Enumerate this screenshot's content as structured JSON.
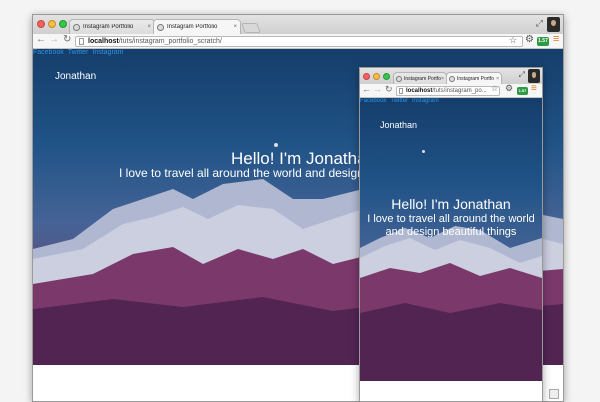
{
  "large_window": {
    "tabs": [
      {
        "title": "Instagram Portfolio",
        "close": "×"
      },
      {
        "title": "Instagram Portfolio",
        "close": "×"
      }
    ],
    "url_host": "localhost",
    "url_path": "/tuts/instagram_portfolio_scratch/",
    "extension_badge": "1.57",
    "page": {
      "social_links": [
        "Facebook",
        "Twitter",
        "Instagram"
      ],
      "brand": "Jonathan",
      "headline": "Hello! I'm Jonathan",
      "subline": "I love to travel all around the world and design beautiful things"
    }
  },
  "small_window": {
    "tabs": [
      {
        "title": "Instagram Portfo",
        "close": "×"
      },
      {
        "title": "Instagram Portfo",
        "close": "×"
      }
    ],
    "url_host": "localhost",
    "url_path": "/tuts/instagram_po...",
    "extension_badge": "1.57",
    "page": {
      "social_links": [
        "Facebook",
        "Twitter",
        "Instagram"
      ],
      "brand": "Jonathan",
      "headline": "Hello! I'm Jonathan",
      "subline": "I love to travel all around the world and design beautiful things"
    }
  },
  "glyphs": {
    "back": "←",
    "forward": "→",
    "reload": "↻",
    "star": "☆",
    "gear": "⚙",
    "menu": "≡",
    "resize": "⤢"
  },
  "colors": {
    "link": "#2d93de",
    "sky_top": "#12436e",
    "mountain_purple": "#6b2a5e"
  }
}
